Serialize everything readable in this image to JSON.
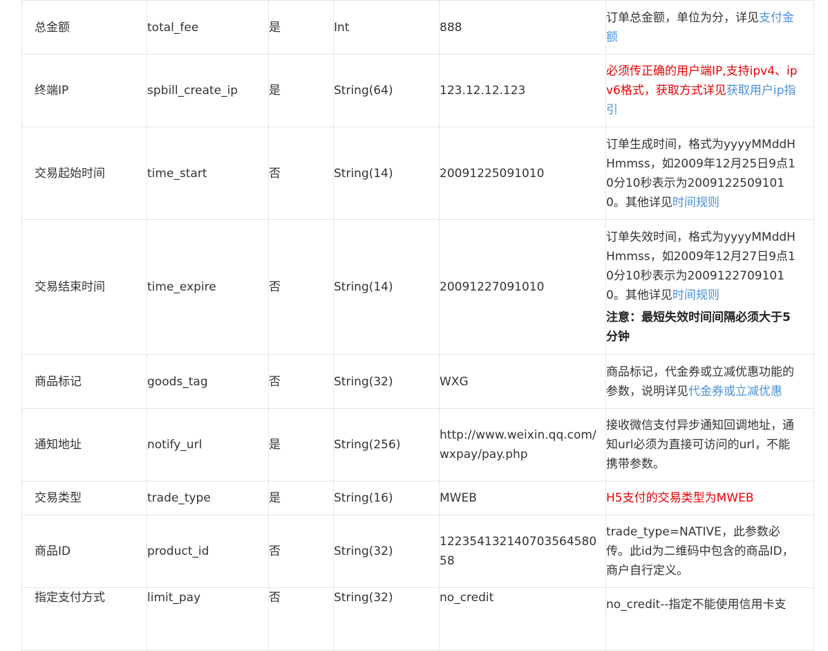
{
  "rows": [
    {
      "name": "总金额",
      "field": "total_fee",
      "required": "是",
      "type": "Int",
      "example": "888",
      "desc_parts": [
        {
          "t": "订单总金额，单位为分，详见",
          "s": "normal"
        },
        {
          "t": "支付金额",
          "s": "link"
        }
      ]
    },
    {
      "name": "终端IP",
      "field": "spbill_create_ip",
      "required": "是",
      "type": "String(64)",
      "example": "123.12.12.123",
      "desc_parts": [
        {
          "t": "必须传正确的用户端IP,支持ipv4、ipv6格式，获取方式详见",
          "s": "red"
        },
        {
          "t": "获取用户ip指引",
          "s": "link"
        }
      ]
    },
    {
      "name": "交易起始时间",
      "field": "time_start",
      "required": "否",
      "type": "String(14)",
      "example": "20091225091010",
      "desc_parts": [
        {
          "t": "订单生成时间，格式为yyyyMMddHHmmss，如2009年12月25日9点10分10秒表示为20091225091010。其他详见",
          "s": "normal"
        },
        {
          "t": "时间规则",
          "s": "link"
        }
      ]
    },
    {
      "name": "交易结束时间",
      "field": "time_expire",
      "required": "否",
      "type": "String(14)",
      "example": "20091227091010",
      "desc_parts": [
        {
          "t": "订单失效时间，格式为yyyyMMddHHmmss，如2009年12月27日9点10分10秒表示为20091227091010。其他详见",
          "s": "normal"
        },
        {
          "t": "时间规则",
          "s": "link"
        }
      ],
      "note": "注意：最短失效时间间隔必须大于5分钟"
    },
    {
      "name": "商品标记",
      "field": "goods_tag",
      "required": "否",
      "type": "String(32)",
      "example": "WXG",
      "desc_parts": [
        {
          "t": "商品标记，代金券或立减优惠功能的参数，说明详见",
          "s": "normal"
        },
        {
          "t": "代金券或立减优惠",
          "s": "link"
        }
      ]
    },
    {
      "name": "通知地址",
      "field": "notify_url",
      "required": "是",
      "type": "String(256)",
      "example": "http://www.weixin.qq.com/wxpay/pay.php",
      "desc_parts": [
        {
          "t": "接收微信支付异步通知回调地址，通知url必须为直接可访问的url，不能携带参数。",
          "s": "normal"
        }
      ]
    },
    {
      "name": "交易类型",
      "field": "trade_type",
      "required": "是",
      "type": "String(16)",
      "example": "MWEB",
      "desc_parts": [
        {
          "t": "H5支付的交易类型为MWEB",
          "s": "red"
        }
      ]
    },
    {
      "name": "商品ID",
      "field": "product_id",
      "required": "否",
      "type": "String(32)",
      "example": "12235413214070356458058",
      "desc_parts": [
        {
          "t": "trade_type=NATIVE，此参数必传。此id为二维码中包含的商品ID，商户自行定义。",
          "s": "normal"
        }
      ]
    },
    {
      "name": "指定支付方式",
      "field": "limit_pay",
      "required": "否",
      "type": "String(32)",
      "example": "no_credit",
      "desc_parts": [
        {
          "t": "no_credit--指定不能使用信用卡支",
          "s": "normal"
        }
      ]
    }
  ]
}
